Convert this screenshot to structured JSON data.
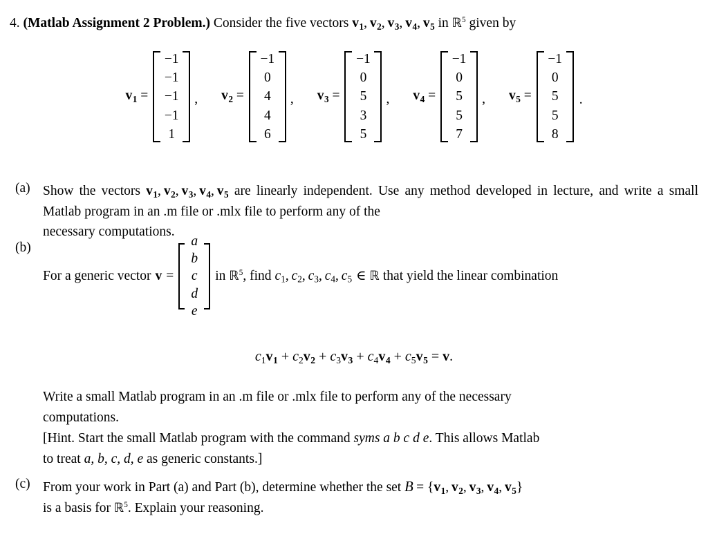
{
  "problem": {
    "number": "4.",
    "title": "(Matlab Assignment 2 Problem.)",
    "intro_before": "Consider the five vectors",
    "vector_list": "v1, v2, v3, v4, v5",
    "intro_after": "in",
    "space": "R",
    "space_exponent": "5",
    "intro_end": "given by"
  },
  "vectors": [
    {
      "name": "v",
      "index": "1",
      "entries": [
        "−1",
        "−1",
        "−1",
        "−1",
        "1"
      ],
      "separator": ","
    },
    {
      "name": "v",
      "index": "2",
      "entries": [
        "−1",
        "0",
        "4",
        "4",
        "6"
      ],
      "separator": ","
    },
    {
      "name": "v",
      "index": "3",
      "entries": [
        "−1",
        "0",
        "5",
        "3",
        "5"
      ],
      "separator": ","
    },
    {
      "name": "v",
      "index": "4",
      "entries": [
        "−1",
        "0",
        "5",
        "5",
        "7"
      ],
      "separator": ","
    },
    {
      "name": "v",
      "index": "5",
      "entries": [
        "−1",
        "0",
        "5",
        "5",
        "8"
      ],
      "separator": "."
    }
  ],
  "equals_sign": "=",
  "parts": {
    "a": {
      "label": "(a)",
      "text_1": "Show the vectors",
      "vectors_inline": "v1, v2, v3, v4, v5",
      "text_2": "are linearly independent.  Use any method developed in lecture, and write a small Matlab program in an .m file or .mlx file to perform any of the",
      "text_3": "necessary computations."
    },
    "b": {
      "label": "(b)",
      "lead": "For a generic vector",
      "vector_symbol": "v",
      "generic_entries": [
        "a",
        "b",
        "c",
        "d",
        "e"
      ],
      "after_bracket_1": "in",
      "space": "R",
      "space_exponent": "5",
      "after_bracket_2": ", find",
      "coefficients": "c1, c2, c3, c4, c5",
      "member_of": "∈",
      "after_bracket_3": "that yield the linear combination",
      "equation": "c1 v1 + c2 v2 + c3 v3 + c4 v4 + c5 v5 = v.",
      "tail_1": "Write a small Matlab program in an .m file or .mlx file to perform any of the necessary",
      "tail_2": "computations.",
      "hint_1_pre": "[Hint. Start the small Matlab program with the command",
      "hint_1_italic": "syms a b c d e",
      "hint_1_post": ". This allows Matlab",
      "hint_2_pre": "to treat",
      "hint_2_italic": "a, b, c, d, e",
      "hint_2_post": "as generic constants.]"
    },
    "c": {
      "label": "(c)",
      "text_1": "From your work in Part (a) and Part (b), determine whether the set",
      "set_symbol": "B",
      "set_equals": "=",
      "set_contents": "{v1, v2, v3, v4, v5}",
      "text_2": "is a basis for",
      "space": "R",
      "space_exponent": "5",
      "text_3": ".  Explain your reasoning."
    }
  },
  "colors": {
    "page_background": "#ffffff",
    "text": "#000000"
  }
}
